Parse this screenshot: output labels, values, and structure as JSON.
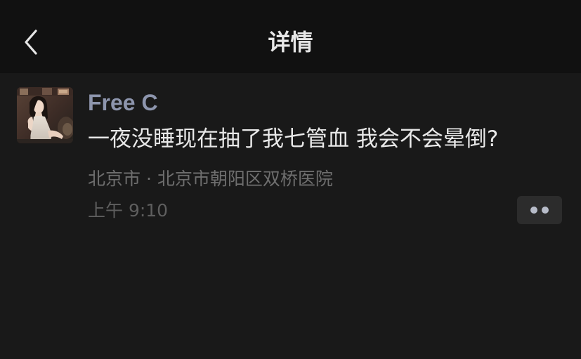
{
  "header": {
    "title": "详情",
    "back_icon": "chevron-left-icon"
  },
  "post": {
    "author": "Free C",
    "avatar": "avatar-photo",
    "content": "一夜没睡现在抽了我七管血 我会不会晕倒?",
    "location": "北京市 · 北京市朝阳区双桥医院",
    "time": "上午 9:10",
    "more_icon": "more-dots-icon"
  },
  "colors": {
    "background": "#191919",
    "header_background": "#111111",
    "author_name": "#8d95ad",
    "primary_text": "#e8e8e8",
    "secondary_text": "#6e6e6e",
    "more_button": "#2c2c2c"
  }
}
